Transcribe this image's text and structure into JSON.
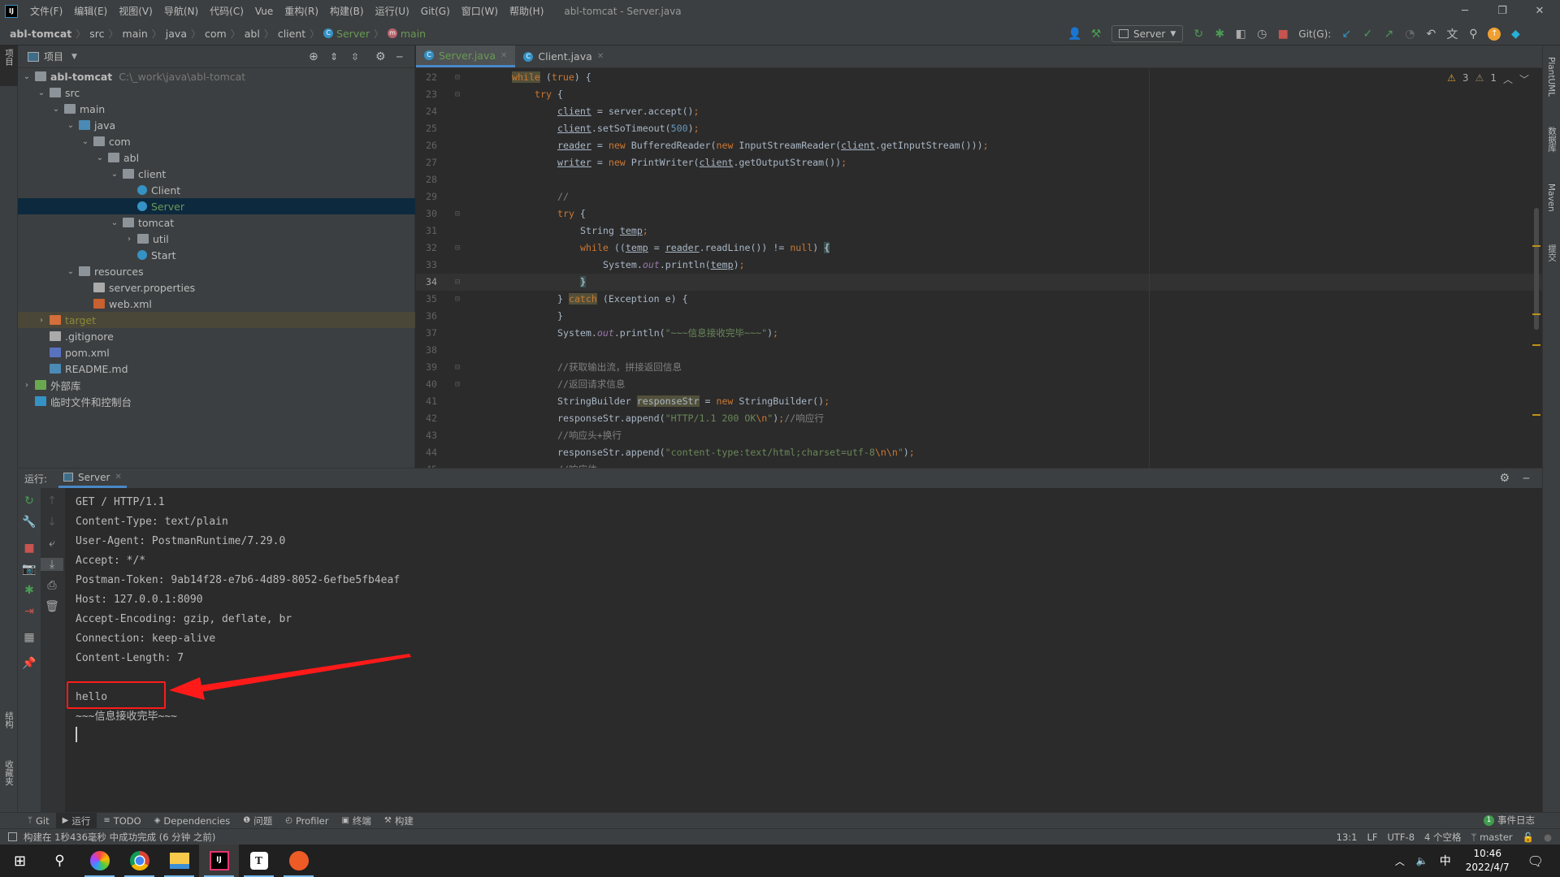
{
  "menubar": {
    "items": [
      "文件(F)",
      "编辑(E)",
      "视图(V)",
      "导航(N)",
      "代码(C)",
      "Vue",
      "重构(R)",
      "构建(B)",
      "运行(U)",
      "Git(G)",
      "窗口(W)",
      "帮助(H)"
    ],
    "window_title": "abl-tomcat - Server.java",
    "logo": "IJ"
  },
  "breadcrumb": [
    "abl-tomcat",
    "src",
    "main",
    "java",
    "com",
    "abl",
    "client",
    "Server",
    "main"
  ],
  "toolbar": {
    "run_config": "Server",
    "git_label": "Git(G):"
  },
  "left_strip": {
    "project": "项目",
    "structure": "结构",
    "favorites": "收藏夹"
  },
  "right_strip": {
    "plantuml": "PlantUML",
    "database": "数据库",
    "maven": "Maven",
    "commit": "提交"
  },
  "project": {
    "title": "项目",
    "tree": [
      {
        "label": "abl-tomcat",
        "path": "C:\\_work\\java\\abl-tomcat",
        "level": 0,
        "arrow": "down",
        "icon": "module",
        "bold": true
      },
      {
        "label": "src",
        "level": 1,
        "arrow": "down",
        "icon": "folder"
      },
      {
        "label": "main",
        "level": 2,
        "arrow": "down",
        "icon": "folder"
      },
      {
        "label": "java",
        "level": 3,
        "arrow": "down",
        "icon": "source-folder"
      },
      {
        "label": "com",
        "level": 4,
        "arrow": "down",
        "icon": "package"
      },
      {
        "label": "abl",
        "level": 5,
        "arrow": "down",
        "icon": "package"
      },
      {
        "label": "client",
        "level": 6,
        "arrow": "down",
        "icon": "package"
      },
      {
        "label": "Client",
        "level": 7,
        "arrow": "",
        "icon": "class"
      },
      {
        "label": "Server",
        "level": 7,
        "arrow": "",
        "icon": "class",
        "selected": true
      },
      {
        "label": "tomcat",
        "level": 6,
        "arrow": "down",
        "icon": "package"
      },
      {
        "label": "util",
        "level": 7,
        "arrow": "right",
        "icon": "package"
      },
      {
        "label": "Start",
        "level": 7,
        "arrow": "",
        "icon": "class"
      },
      {
        "label": "resources",
        "level": 3,
        "arrow": "down",
        "icon": "resources-folder"
      },
      {
        "label": "server.properties",
        "level": 4,
        "arrow": "",
        "icon": "properties-file"
      },
      {
        "label": "web.xml",
        "level": 4,
        "arrow": "",
        "icon": "xml-file"
      },
      {
        "label": "target",
        "level": 1,
        "arrow": "right",
        "icon": "excluded-folder",
        "ignored": true
      },
      {
        "label": ".gitignore",
        "level": 1,
        "arrow": "",
        "icon": "ignore-file"
      },
      {
        "label": "pom.xml",
        "level": 1,
        "arrow": "",
        "icon": "maven-file"
      },
      {
        "label": "README.md",
        "level": 1,
        "arrow": "",
        "icon": "markdown-file"
      },
      {
        "label": "外部库",
        "level": 0,
        "arrow": "right",
        "icon": "library"
      },
      {
        "label": "临时文件和控制台",
        "level": 0,
        "arrow": "",
        "icon": "scratches"
      }
    ]
  },
  "editor": {
    "tabs": [
      {
        "label": "Server.java",
        "active": true
      },
      {
        "label": "Client.java",
        "active": false
      }
    ],
    "warnings": {
      "warning_count": "3",
      "weak_warning_count": "1"
    },
    "current_line": 34,
    "lines": [
      {
        "n": 22,
        "indent": 0,
        "tokens": [
          [
            "while",
            "kw hl"
          ],
          [
            " (",
            "plain"
          ],
          [
            "true",
            "kw"
          ],
          [
            ") {",
            "plain"
          ]
        ]
      },
      {
        "n": 23,
        "indent": 1,
        "tokens": [
          [
            "try",
            "kw"
          ],
          [
            " {",
            "plain"
          ]
        ]
      },
      {
        "n": 24,
        "indent": 2,
        "tokens": [
          [
            "client",
            "u"
          ],
          [
            " = server.accept()",
            "plain"
          ],
          [
            ";",
            "p"
          ]
        ]
      },
      {
        "n": 25,
        "indent": 2,
        "tokens": [
          [
            "client",
            "u"
          ],
          [
            ".setSoTimeout(",
            "plain"
          ],
          [
            "500",
            "num"
          ],
          [
            ")",
            "plain"
          ],
          [
            ";",
            "p"
          ]
        ]
      },
      {
        "n": 26,
        "indent": 2,
        "tokens": [
          [
            "reader",
            "u"
          ],
          [
            " = ",
            "plain"
          ],
          [
            "new",
            "kw"
          ],
          [
            " BufferedReader(",
            "plain"
          ],
          [
            "new",
            "kw"
          ],
          [
            " InputStreamReader(",
            "plain"
          ],
          [
            "client",
            "u"
          ],
          [
            ".getInputStream()))",
            "plain"
          ],
          [
            ";",
            "p"
          ]
        ]
      },
      {
        "n": 27,
        "indent": 2,
        "tokens": [
          [
            "writer",
            "u"
          ],
          [
            " = ",
            "plain"
          ],
          [
            "new",
            "kw"
          ],
          [
            " PrintWriter(",
            "plain"
          ],
          [
            "client",
            "u"
          ],
          [
            ".getOutputStream())",
            "plain"
          ],
          [
            ";",
            "p"
          ]
        ]
      },
      {
        "n": 28,
        "indent": 0,
        "tokens": []
      },
      {
        "n": 29,
        "indent": 2,
        "tokens": [
          [
            "//",
            "cm"
          ]
        ]
      },
      {
        "n": 30,
        "indent": 2,
        "tokens": [
          [
            "try",
            "kw"
          ],
          [
            " {",
            "plain"
          ]
        ]
      },
      {
        "n": 31,
        "indent": 3,
        "tokens": [
          [
            "String ",
            "plain"
          ],
          [
            "temp",
            "u"
          ],
          [
            ";",
            "p"
          ]
        ]
      },
      {
        "n": 32,
        "indent": 3,
        "tokens": [
          [
            "while",
            "kw"
          ],
          [
            " ((",
            "plain"
          ],
          [
            "temp",
            "u"
          ],
          [
            " = ",
            "plain"
          ],
          [
            "reader",
            "u"
          ],
          [
            ".readLine()) != ",
            "plain"
          ],
          [
            "null",
            "kw"
          ],
          [
            ") ",
            "plain"
          ],
          [
            "{",
            "br"
          ]
        ]
      },
      {
        "n": 33,
        "indent": 4,
        "tokens": [
          [
            "System.",
            "plain"
          ],
          [
            "out",
            "st"
          ],
          [
            ".println(",
            "plain"
          ],
          [
            "temp",
            "u"
          ],
          [
            ")",
            "plain"
          ],
          [
            ";",
            "p"
          ]
        ]
      },
      {
        "n": 34,
        "indent": 3,
        "tokens": [
          [
            "}",
            "br"
          ]
        ]
      },
      {
        "n": 35,
        "indent": 2,
        "tokens": [
          [
            "} ",
            "plain"
          ],
          [
            "catch",
            "kw hl"
          ],
          [
            " (Exception e) {",
            "plain"
          ]
        ]
      },
      {
        "n": 36,
        "indent": 2,
        "tokens": [
          [
            "}",
            "plain"
          ]
        ]
      },
      {
        "n": 37,
        "indent": 2,
        "tokens": [
          [
            "System.",
            "plain"
          ],
          [
            "out",
            "st"
          ],
          [
            ".println(",
            "plain"
          ],
          [
            "\"~~~信息接收完毕~~~\"",
            "str"
          ],
          [
            ")",
            "plain"
          ],
          [
            ";",
            "p"
          ]
        ]
      },
      {
        "n": 38,
        "indent": 0,
        "tokens": []
      },
      {
        "n": 39,
        "indent": 2,
        "tokens": [
          [
            "//获取输出流，拼接返回信息",
            "cm"
          ]
        ]
      },
      {
        "n": 40,
        "indent": 2,
        "tokens": [
          [
            "//返回请求信息",
            "cm"
          ]
        ]
      },
      {
        "n": 41,
        "indent": 2,
        "tokens": [
          [
            "StringBuilder ",
            "plain"
          ],
          [
            "responseStr",
            "hl"
          ],
          [
            " = ",
            "plain"
          ],
          [
            "new",
            "kw"
          ],
          [
            " StringBuilder()",
            "plain"
          ],
          [
            ";",
            "p"
          ]
        ]
      },
      {
        "n": 42,
        "indent": 2,
        "tokens": [
          [
            "responseStr.append(",
            "plain"
          ],
          [
            "\"HTTP/1.1 200 OK",
            "str"
          ],
          [
            "\\n",
            "esc"
          ],
          [
            "\"",
            "str"
          ],
          [
            ")",
            "plain"
          ],
          [
            ";",
            "p"
          ],
          [
            "//响应行",
            "cm"
          ]
        ]
      },
      {
        "n": 43,
        "indent": 2,
        "tokens": [
          [
            "//响应头+换行",
            "cm"
          ]
        ]
      },
      {
        "n": 44,
        "indent": 2,
        "tokens": [
          [
            "responseStr.append(",
            "plain"
          ],
          [
            "\"content-type:text/html;charset=utf-8",
            "str"
          ],
          [
            "\\n\\n",
            "esc"
          ],
          [
            "\"",
            "str"
          ],
          [
            ")",
            "plain"
          ],
          [
            ";",
            "p"
          ]
        ]
      },
      {
        "n": 45,
        "indent": 2,
        "tokens": [
          [
            "//响应体",
            "cm"
          ]
        ]
      }
    ]
  },
  "run": {
    "label": "运行:",
    "tab": "Server",
    "console": [
      "GET / HTTP/1.1",
      "Content-Type: text/plain",
      "User-Agent: PostmanRuntime/7.29.0",
      "Accept: */*",
      "Postman-Token: 9ab14f28-e7b6-4d89-8052-6efbe5fb4eaf",
      "Host: 127.0.0.1:8090",
      "Accept-Encoding: gzip, deflate, br",
      "Connection: keep-alive",
      "Content-Length: 7",
      "",
      "hello",
      "~~~信息接收完毕~~~"
    ]
  },
  "annotation": {
    "color": "#ff1a1a",
    "highlighted_text": "hello"
  },
  "bottom_tools": [
    {
      "label": "Git",
      "icon": "git-icon"
    },
    {
      "label": "运行",
      "icon": "run-icon",
      "active": true
    },
    {
      "label": "TODO",
      "icon": "list-icon"
    },
    {
      "label": "Dependencies",
      "icon": "layers-icon"
    },
    {
      "label": "问题",
      "icon": "problems-icon"
    },
    {
      "label": "Profiler",
      "icon": "profiler-icon"
    },
    {
      "label": "终端",
      "icon": "terminal-icon"
    },
    {
      "label": "构建",
      "icon": "hammer-icon"
    }
  ],
  "event_log": {
    "count": "1",
    "label": "事件日志"
  },
  "status": {
    "message": "构建在 1秒436毫秒 中成功完成 (6 分钟 之前)",
    "position": "13:1",
    "line_sep": "LF",
    "encoding": "UTF-8",
    "indent": "4 个空格",
    "branch": "master"
  },
  "taskbar": {
    "time": "10:46",
    "date": "2022/4/7",
    "ime": "中"
  },
  "colors": {
    "accent": "#4a88c7",
    "keyword": "#cc7832",
    "string": "#6a8759",
    "selection": "#0d293e"
  }
}
